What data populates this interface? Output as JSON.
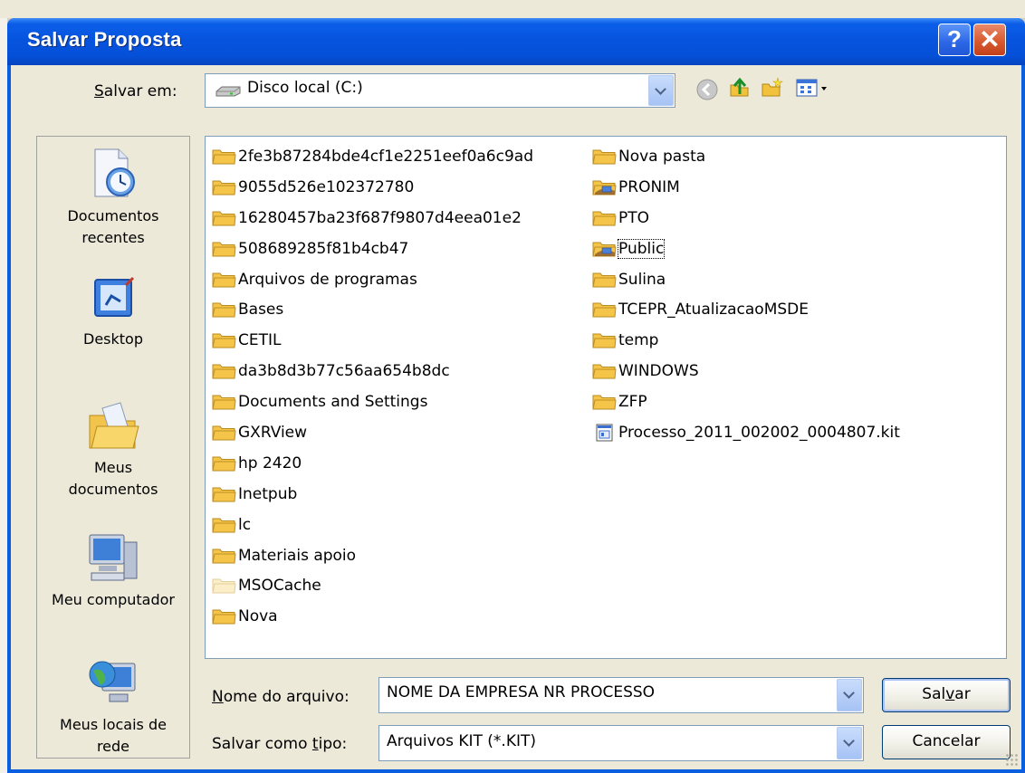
{
  "window": {
    "title": "Salvar Proposta"
  },
  "savein": {
    "label_prefix": "S",
    "label_rest": "alvar em:",
    "value": "Disco local (C:)"
  },
  "places": [
    {
      "label": "Documentos\nrecentes"
    },
    {
      "label": "Desktop"
    },
    {
      "label": "Meus\ndocumentos"
    },
    {
      "label": "Meu computador"
    },
    {
      "label": "Meus locais de\nrede"
    }
  ],
  "files": {
    "col1": [
      {
        "name": "2fe3b87284bde4cf1e2251eef0a6c9ad",
        "icon": "folder"
      },
      {
        "name": "9055d526e102372780",
        "icon": "folder"
      },
      {
        "name": "16280457ba23f687f9807d4eea01e2",
        "icon": "folder"
      },
      {
        "name": "508689285f81b4cb47",
        "icon": "folder"
      },
      {
        "name": "Arquivos de programas",
        "icon": "folder"
      },
      {
        "name": "Bases",
        "icon": "folder"
      },
      {
        "name": "CETIL",
        "icon": "folder"
      },
      {
        "name": "da3b8d3b77c56aa654b8dc",
        "icon": "folder"
      },
      {
        "name": "Documents and Settings",
        "icon": "folder"
      },
      {
        "name": "GXRView",
        "icon": "folder"
      },
      {
        "name": "hp 2420",
        "icon": "folder"
      },
      {
        "name": "Inetpub",
        "icon": "folder"
      },
      {
        "name": "lc",
        "icon": "folder"
      },
      {
        "name": "Materiais apoio",
        "icon": "folder"
      },
      {
        "name": "MSOCache",
        "icon": "folder-hidden"
      },
      {
        "name": "Nova",
        "icon": "folder"
      }
    ],
    "col2": [
      {
        "name": "Nova pasta",
        "icon": "folder"
      },
      {
        "name": "PRONIM",
        "icon": "folder-shared"
      },
      {
        "name": "PTO",
        "icon": "folder"
      },
      {
        "name": "Public",
        "icon": "folder-shared"
      },
      {
        "name": "Sulina",
        "icon": "folder"
      },
      {
        "name": "TCEPR_AtualizacaoMSDE",
        "icon": "folder"
      },
      {
        "name": "temp",
        "icon": "folder"
      },
      {
        "name": "WINDOWS",
        "icon": "folder"
      },
      {
        "name": "ZFP",
        "icon": "folder"
      },
      {
        "name": "Processo_2011_002002_0004807.kit",
        "icon": "kit-file"
      }
    ]
  },
  "filename": {
    "label_prefix": "N",
    "label_rest": "ome do arquivo:",
    "value": "NOME DA EMPRESA NR PROCESSO"
  },
  "filetype": {
    "label_start": "Salvar como ",
    "label_underlined": "t",
    "label_end": "ipo:",
    "value": "Arquivos KIT (*.KIT)"
  },
  "buttons": {
    "save_start": "Sal",
    "save_underlined": "v",
    "save_end": "ar",
    "cancel": "Cancelar"
  },
  "colors": {
    "title_bar": "#0553d9",
    "folder": "#f5c54a",
    "window_frame": "#0a5ee0"
  }
}
